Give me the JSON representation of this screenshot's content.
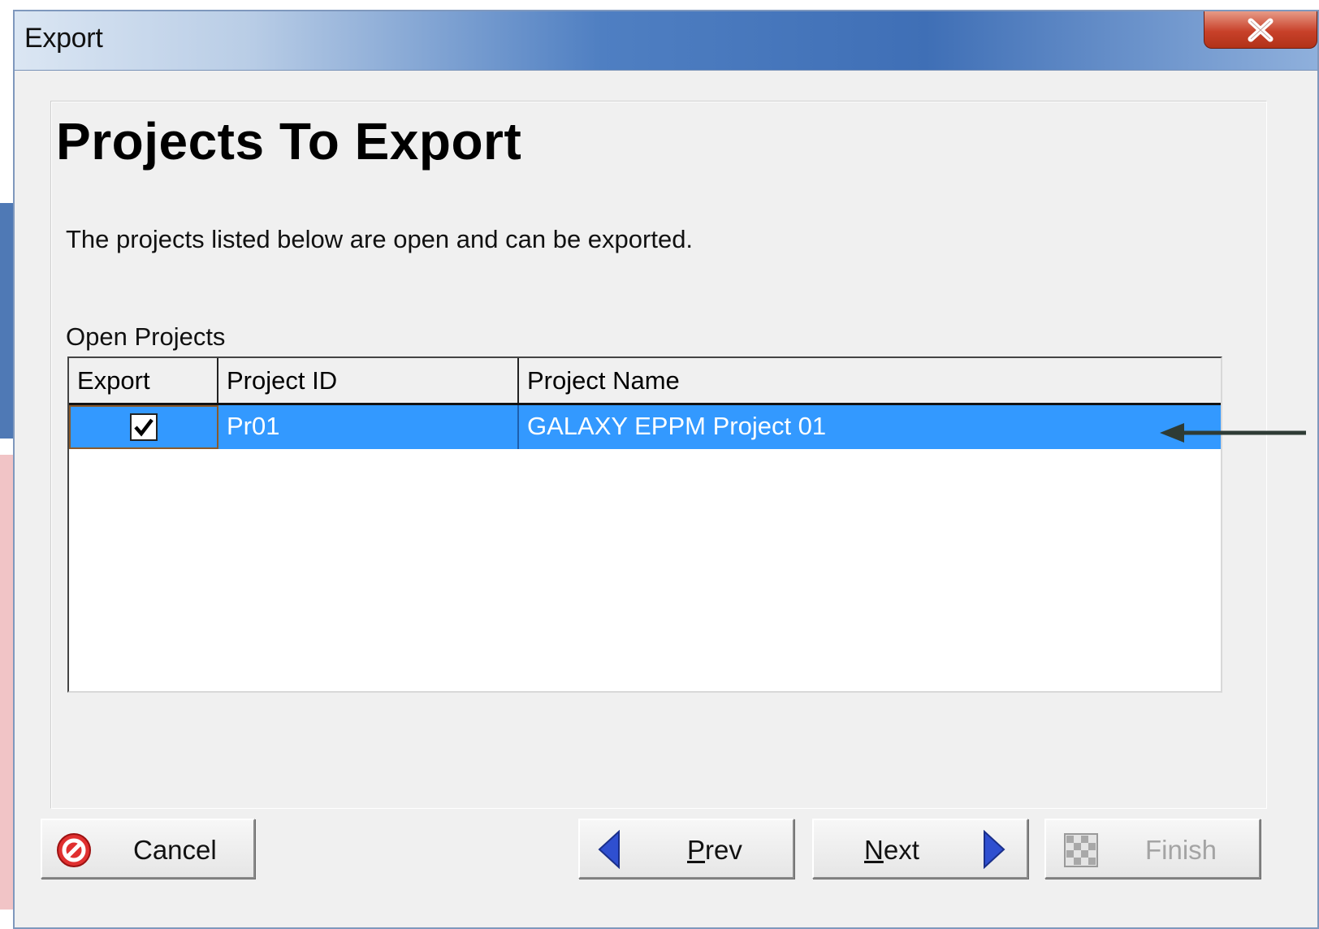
{
  "window": {
    "title": "Export"
  },
  "page": {
    "heading": "Projects To Export",
    "description": "The projects listed below are open and can be exported.",
    "open_projects_label": "Open Projects"
  },
  "table": {
    "columns": [
      "Export",
      "Project ID",
      "Project Name"
    ],
    "rows": [
      {
        "export_checked": true,
        "project_id": "Pr01",
        "project_name": "GALAXY EPPM Project 01"
      }
    ]
  },
  "buttons": {
    "cancel": "Cancel",
    "prev_mnemonic": "P",
    "prev_rest": "rev",
    "next_mnemonic": "N",
    "next_rest": "ext",
    "finish": "Finish"
  },
  "icons": {
    "close": "close-icon",
    "cancel": "no-entry-icon",
    "prev": "triangle-left-icon",
    "next": "triangle-right-icon",
    "finish": "checkered-flag-icon",
    "checkbox": "checkmark-icon"
  },
  "colors": {
    "selection": "#3399ff",
    "titlebar": "#3f6fb6",
    "close": "#c8412a",
    "arrow_icon": "#2f4fd0"
  }
}
